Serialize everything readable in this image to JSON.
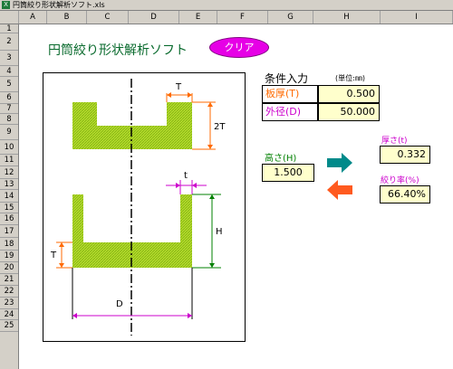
{
  "window": {
    "title": "円筒絞り形状解析ソフト.xls",
    "app_icon": "excel-icon"
  },
  "columns": [
    "A",
    "B",
    "C",
    "D",
    "E",
    "F",
    "G",
    "H",
    "I"
  ],
  "rows": [
    "1",
    "2",
    "3",
    "4",
    "5",
    "6",
    "7",
    "8",
    "9",
    "10",
    "11",
    "12",
    "13",
    "14",
    "15",
    "16",
    "17",
    "18",
    "19",
    "20",
    "21",
    "22",
    "23",
    "24",
    "25"
  ],
  "app": {
    "title": "円筒絞り形状解析ソフト",
    "clear_label": "クリア"
  },
  "conditions": {
    "header": "条件入力",
    "unit": "(単位:㎜)",
    "thickness_label": "板厚(T)",
    "thickness_value": "0.500",
    "diameter_label": "外径(D)",
    "diameter_value": "50.000"
  },
  "height": {
    "label": "高さ(H)",
    "value": "1.500"
  },
  "results": {
    "thickness_label": "厚さ(t)",
    "thickness_value": "0.332",
    "ratio_label": "絞り率(%)",
    "ratio_value": "66.40%"
  },
  "diagram": {
    "T": "T",
    "2T": "2T",
    "t": "t",
    "H": "H",
    "T2": "T",
    "D": "D"
  },
  "colors": {
    "hatch": "#a8d22a",
    "orange": "#ff6a00",
    "green_dim": "#008000",
    "magenta": "#cc00cc",
    "teal_arrow": "#008a8a",
    "orange_arrow": "#ff5a1f",
    "input_bg": "#ffffcc"
  }
}
